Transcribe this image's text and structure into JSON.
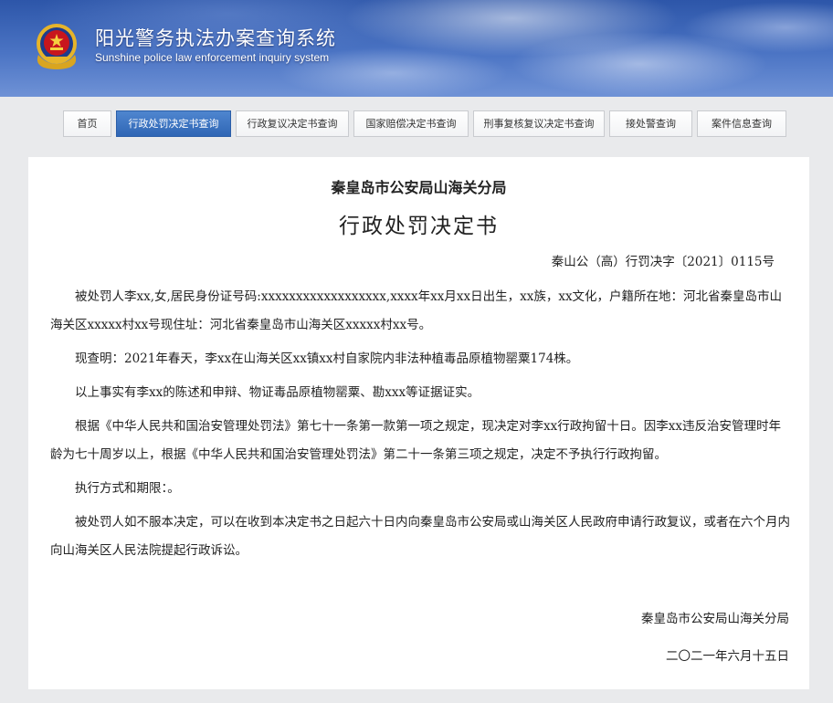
{
  "header": {
    "title": "阳光警务执法办案查询系统",
    "subtitle": "Sunshine police law enforcement inquiry system",
    "emblem_icon": "police-emblem-icon",
    "colors": {
      "banner": "#3b64b8",
      "active_tab": "#3a72c0"
    }
  },
  "nav": {
    "items": [
      {
        "label": "首页"
      },
      {
        "label": "行政处罚决定书查询"
      },
      {
        "label": "行政复议决定书查询"
      },
      {
        "label": "国家赔偿决定书查询"
      },
      {
        "label": "刑事复核复议决定书查询"
      },
      {
        "label": "接处警查询"
      },
      {
        "label": "案件信息查询"
      }
    ],
    "active_index": 1
  },
  "document": {
    "org_title": "秦皇岛市公安局山海关分局",
    "doc_title": "行政处罚决定书",
    "doc_number": "秦山公（高）行罚决字〔2021〕0115号",
    "paragraphs": [
      "被处罚人李xx,女,居民身份证号码:xxxxxxxxxxxxxxxxxx,xxxx年xx月xx日出生，xx族，xx文化，户籍所在地：河北省秦皇岛市山海关区xxxxx村xx号现住址：河北省秦皇岛市山海关区xxxxx村xx号。",
      "现查明：2021年春天，李xx在山海关区xx镇xx村自家院内非法种植毒品原植物罂粟174株。",
      "以上事实有李xx的陈述和申辩、物证毒品原植物罂粟、勘xxx等证据证实。",
      "根据《中华人民共和国治安管理处罚法》第七十一条第一款第一项之规定，现决定对李xx行政拘留十日。因李xx违反治安管理时年龄为七十周岁以上，根据《中华人民共和国治安管理处罚法》第二十一条第三项之规定，决定不予执行行政拘留。",
      "执行方式和期限：。",
      "被处罚人如不服本决定，可以在收到本决定书之日起六十日内向秦皇岛市公安局或山海关区人民政府申请行政复议，或者在六个月内向山海关区人民法院提起行政诉讼。"
    ],
    "sign_org": "秦皇岛市公安局山海关分局",
    "sign_date": "二〇二一年六月十五日"
  }
}
